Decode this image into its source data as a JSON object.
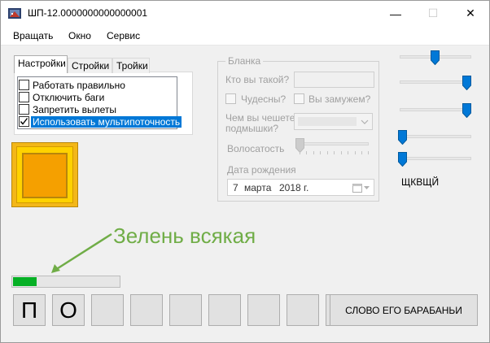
{
  "window": {
    "title": "ШП-12.0000000000000001",
    "controls": {
      "minimize": "—",
      "maximize": "☐",
      "close": "✕"
    },
    "icon": "app-icon"
  },
  "menu": {
    "items": [
      "Вращать",
      "Окно",
      "Сервис"
    ]
  },
  "tabs": {
    "items": [
      "Настройки",
      "Стройки",
      "Тройки"
    ],
    "active": "Настройки"
  },
  "settings": {
    "options": [
      {
        "label": "Работать правильно",
        "checked": false
      },
      {
        "label": "Отключить баги",
        "checked": false
      },
      {
        "label": "Запретить вылеты",
        "checked": false
      },
      {
        "label": "Использовать мультипоточность",
        "checked": true,
        "selected": true
      }
    ]
  },
  "blanka": {
    "title": "Бланка",
    "who_label": "Кто вы такой?",
    "who_value": "",
    "checkbox1": "Чудесны?",
    "checkbox2": "Вы замужем?",
    "scratch_label_line1": "Чем вы чешете",
    "scratch_label_line2": "подмышки?",
    "hair_label": "Волосатость",
    "hair_level": 0,
    "birth_label": "Дата рождения",
    "birth_day": "7",
    "birth_month": "марта",
    "birth_year": "2018 г."
  },
  "sliders": {
    "levels": [
      0.5,
      1.0,
      1.0,
      0.0,
      0.0
    ],
    "label": "ЩКВЩЙ"
  },
  "annotation": {
    "text": "Зелень всякая",
    "color": "#70ad47"
  },
  "progress": {
    "value": 0.22,
    "color": "#06b025"
  },
  "letters": [
    "П",
    "О",
    "",
    "",
    "",
    "",
    "",
    "",
    ""
  ],
  "action_button": "СЛОВО ЕГО БАРАБАНЬИ",
  "colors": {
    "accent": "#0078d7",
    "orange": "#f5a000",
    "gold": "#ffd200"
  }
}
